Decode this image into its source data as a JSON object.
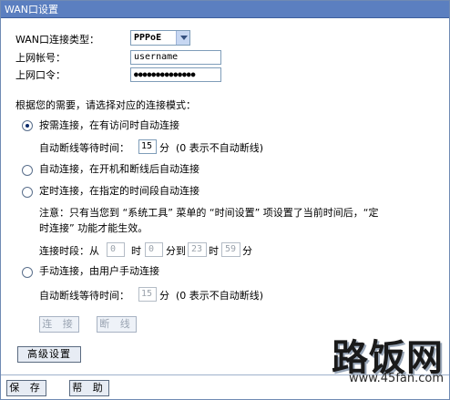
{
  "window": {
    "title": "WAN口设置"
  },
  "wan": {
    "type_label": "WAN口连接类型：",
    "type_value": "PPPoE",
    "account_label": "上网帐号：",
    "account_value": "username",
    "password_label": "上网口令：",
    "password_value": "●●●●●●●●●●●●●●"
  },
  "mode_prompt": "根据您的需要，请选择对应的连接模式：",
  "modes": {
    "on_demand": {
      "label": "按需连接，在有访问时自动连接",
      "selected": true
    },
    "idle1": {
      "prefix": "自动断线等待时间：",
      "value": "15",
      "unit": "分",
      "note": "(0 表示不自动断线)"
    },
    "auto": {
      "label": "自动连接，在开机和断线后自动连接",
      "selected": false
    },
    "timed": {
      "label": "定时连接，在指定的时间段自动连接",
      "selected": false
    },
    "timed_note_line1": "注意：只有当您到 “系统工具” 菜单的 “时间设置” 项设置了当前时间后，“定",
    "timed_note_line2": "时连接” 功能才能生效。",
    "period": {
      "prefix": "连接时段：从",
      "from_hour": "0",
      "hour_label": "时",
      "from_min": "0",
      "to_label": "分到",
      "to_hour": "23",
      "hour_label2": "时",
      "to_min": "59",
      "min_label": "分"
    },
    "manual": {
      "label": "手动连接，由用户手动连接",
      "selected": false
    },
    "idle2": {
      "prefix": "自动断线等待时间：",
      "value": "15",
      "unit": "分",
      "note": "(0 表示不自动断线)"
    }
  },
  "buttons": {
    "connect": "连 接",
    "disconnect": "断 线",
    "advanced": "高级设置",
    "save": "保 存",
    "help": "帮 助"
  },
  "watermark": {
    "brand": "路饭网",
    "url": "www.45fan.com"
  }
}
